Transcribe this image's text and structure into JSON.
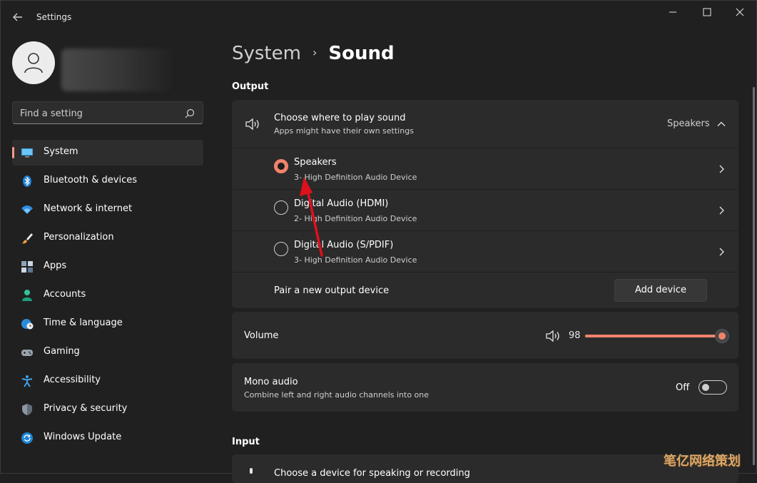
{
  "window": {
    "title": "Settings"
  },
  "sidebar": {
    "search_placeholder": "Find a setting",
    "items": [
      {
        "label": "System",
        "icon": "monitor-icon",
        "selected": true
      },
      {
        "label": "Bluetooth & devices",
        "icon": "bluetooth-icon"
      },
      {
        "label": "Network & internet",
        "icon": "wifi-icon"
      },
      {
        "label": "Personalization",
        "icon": "brush-icon"
      },
      {
        "label": "Apps",
        "icon": "apps-icon"
      },
      {
        "label": "Accounts",
        "icon": "person-icon"
      },
      {
        "label": "Time & language",
        "icon": "globe-clock-icon"
      },
      {
        "label": "Gaming",
        "icon": "gamepad-icon"
      },
      {
        "label": "Accessibility",
        "icon": "accessibility-icon"
      },
      {
        "label": "Privacy & security",
        "icon": "shield-icon"
      },
      {
        "label": "Windows Update",
        "icon": "update-icon"
      }
    ]
  },
  "breadcrumb": {
    "parent": "System",
    "separator": "›",
    "current": "Sound"
  },
  "output": {
    "section_title": "Output",
    "chooser": {
      "title": "Choose where to play sound",
      "subtitle": "Apps might have their own settings",
      "selected": "Speakers"
    },
    "devices": [
      {
        "name": "Speakers",
        "detail": "3- High Definition Audio Device",
        "selected": true
      },
      {
        "name": "Digital Audio (HDMI)",
        "detail": "2- High Definition Audio Device",
        "selected": false
      },
      {
        "name": "Digital Audio (S/PDIF)",
        "detail": "3- High Definition Audio Device",
        "selected": false
      }
    ],
    "pair_label": "Pair a new output device",
    "add_device_label": "Add device",
    "volume": {
      "label": "Volume",
      "value": "98",
      "fraction": 0.98
    },
    "mono": {
      "title": "Mono audio",
      "subtitle": "Combine left and right audio channels into one",
      "state": "Off"
    }
  },
  "input": {
    "section_title": "Input",
    "chooser_title": "Choose a device for speaking or recording"
  },
  "watermark": "笔亿网络策划",
  "colors": {
    "accent": "#f0836c",
    "background": "#202020",
    "card": "#2b2b2b",
    "annotation_arrow": "#e0101c"
  }
}
